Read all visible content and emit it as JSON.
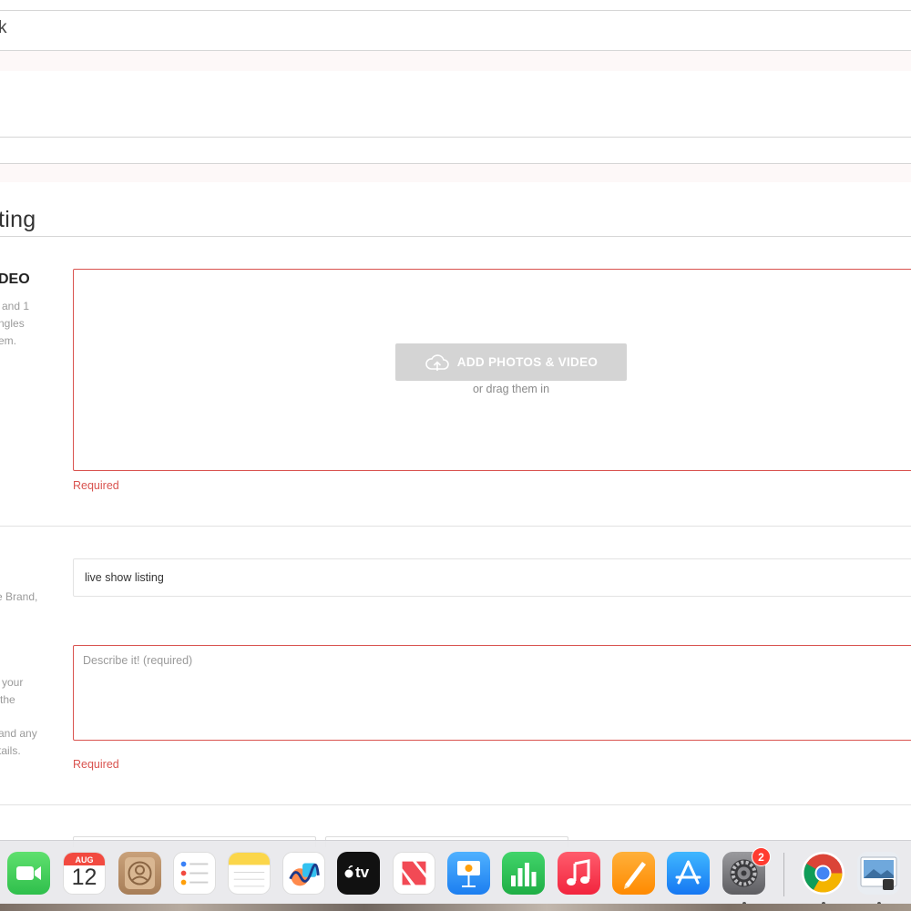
{
  "header": {
    "truncated_text": "k"
  },
  "page": {
    "title": "ting"
  },
  "photos_section": {
    "label": "DEO",
    "help_lines": [
      "and 1",
      "ngles",
      "em."
    ],
    "button_label": "ADD PHOTOS & VIDEO",
    "drag_text": "or drag them in",
    "error": "Required"
  },
  "title_section": {
    "help_lines": [
      "e Brand,"
    ],
    "value": "live show listing"
  },
  "description_section": {
    "help_lines": [
      "your",
      "the",
      "and any",
      "tails."
    ],
    "placeholder": "Describe it! (required)",
    "error": "Required"
  },
  "colors": {
    "error": "#d9534f",
    "upload_button": "#d4d4d4",
    "badge": "#ff3b30"
  },
  "dock": {
    "apps": [
      {
        "name": "FaceTime",
        "icon": "facetime-icon"
      },
      {
        "name": "Calendar",
        "icon": "calendar-icon",
        "month": "AUG",
        "day": "12"
      },
      {
        "name": "Contacts",
        "icon": "contacts-icon"
      },
      {
        "name": "Reminders",
        "icon": "reminders-icon"
      },
      {
        "name": "Notes",
        "icon": "notes-icon"
      },
      {
        "name": "Freeform",
        "icon": "freeform-icon"
      },
      {
        "name": "TV",
        "icon": "apple-tv-icon",
        "label": "tv"
      },
      {
        "name": "News",
        "icon": "news-icon"
      },
      {
        "name": "Keynote",
        "icon": "keynote-icon"
      },
      {
        "name": "Numbers",
        "icon": "numbers-icon"
      },
      {
        "name": "Music",
        "icon": "music-icon"
      },
      {
        "name": "Pages",
        "icon": "pages-icon"
      },
      {
        "name": "App Store",
        "icon": "app-store-icon"
      },
      {
        "name": "System Settings",
        "icon": "settings-icon",
        "badge": "2"
      },
      {
        "name": "Chrome",
        "icon": "chrome-icon"
      },
      {
        "name": "Preview",
        "icon": "preview-icon"
      }
    ]
  }
}
